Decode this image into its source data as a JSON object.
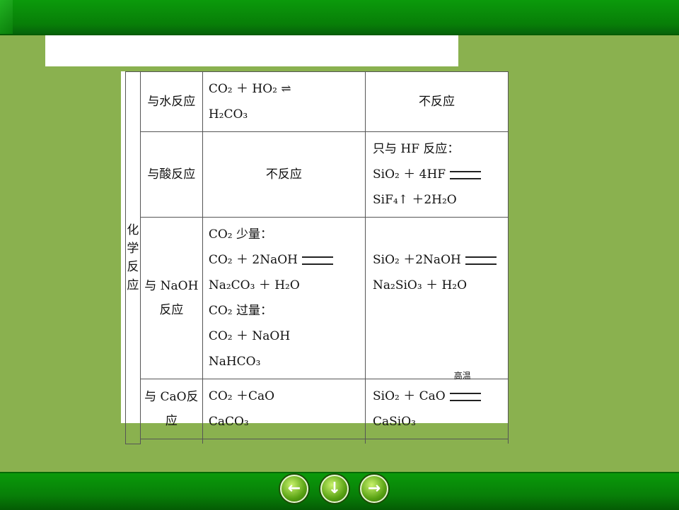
{
  "table": {
    "category": "化学反应",
    "rows": [
      {
        "head": "与水反应",
        "co2": [
          "CO₂ ＋ HO₂ ⇌",
          "H₂CO₃"
        ],
        "sio2": [
          "不反应"
        ]
      },
      {
        "head": "与酸反应",
        "co2": [
          "不反应"
        ],
        "sio2": [
          "只与 HF 反应：",
          "SiO₂ ＋ 4HF",
          "SiF₄↑ ＋2H₂O"
        ]
      },
      {
        "head": "与 NaOH反应",
        "co2": [
          "CO₂ 少量：",
          "CO₂ ＋ 2NaOH",
          "Na₂CO₃ ＋ H₂O",
          "CO₂ 过量：",
          "CO₂ ＋ NaOH",
          "NaHCO₃"
        ],
        "sio2": [
          "SiO₂ ＋2NaOH",
          "Na₂SiO₃ ＋ H₂O"
        ]
      },
      {
        "head": "与 CaO反应",
        "co2": [
          "CO₂ ＋CaO",
          "CaCO₃"
        ],
        "sio2": [
          "SiO₂ ＋ CaO",
          "CaSiO₃"
        ],
        "condition": "高温"
      }
    ]
  },
  "nav": {
    "back_icon": "←",
    "down_icon": "↓",
    "next_icon": "→"
  }
}
